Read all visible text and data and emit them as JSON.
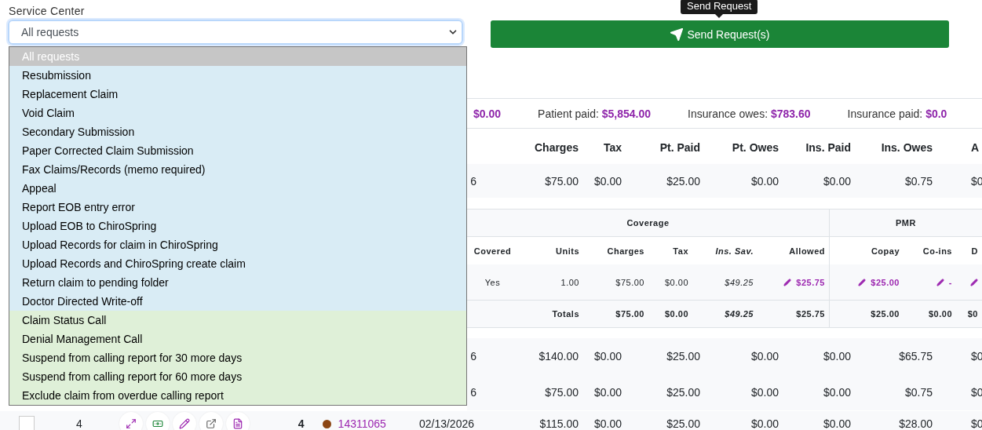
{
  "service_center": {
    "label": "Service Center",
    "value": "All requests",
    "options": [
      {
        "label": "All requests",
        "kind": "request",
        "selected": true
      },
      {
        "label": "Resubmission",
        "kind": "request",
        "selected": false
      },
      {
        "label": "Replacement Claim",
        "kind": "request",
        "selected": false
      },
      {
        "label": "Void Claim",
        "kind": "request",
        "selected": false
      },
      {
        "label": "Secondary Submission",
        "kind": "request",
        "selected": false
      },
      {
        "label": "Paper Corrected Claim Submission",
        "kind": "request",
        "selected": false
      },
      {
        "label": "Fax Claims/Records (memo required)",
        "kind": "request",
        "selected": false
      },
      {
        "label": "Appeal",
        "kind": "request",
        "selected": false
      },
      {
        "label": "Report EOB entry error",
        "kind": "request",
        "selected": false
      },
      {
        "label": "Upload EOB to ChiroSpring",
        "kind": "request",
        "selected": false
      },
      {
        "label": "Upload Records for claim in ChiroSpring",
        "kind": "request",
        "selected": false
      },
      {
        "label": "Upload Records and ChiroSpring create claim",
        "kind": "request",
        "selected": false
      },
      {
        "label": "Return claim to pending folder",
        "kind": "request",
        "selected": false
      },
      {
        "label": "Doctor Directed Write-off",
        "kind": "request",
        "selected": false
      },
      {
        "label": "Claim Status Call",
        "kind": "call",
        "selected": false
      },
      {
        "label": "Denial Management Call",
        "kind": "call",
        "selected": false
      },
      {
        "label": "Suspend from calling report for 30 more days",
        "kind": "call",
        "selected": false
      },
      {
        "label": "Suspend from calling report for 60 more days",
        "kind": "call",
        "selected": false
      },
      {
        "label": "Exclude claim from overdue calling report",
        "kind": "call",
        "selected": false
      }
    ]
  },
  "send_button": {
    "label": "Send Request(s)",
    "tooltip": "Send Request"
  },
  "summary": [
    {
      "value": "$0.00"
    },
    {
      "label": "Patient paid:",
      "value": "$5,854.00"
    },
    {
      "label": "Insurance owes:",
      "value": "$783.60"
    },
    {
      "label": "Insurance paid:",
      "value": "$0.0"
    }
  ],
  "claims": {
    "columns": [
      "Charges",
      "Tax",
      "Pt. Paid",
      "Pt. Owes",
      "Ins. Paid",
      "Ins. Owes",
      "A"
    ],
    "rows": [
      {
        "kind": "partial",
        "date": "6",
        "cells": [
          "$75.00",
          "$0.00",
          "$25.00",
          "$0.00",
          "$0.00",
          "$0.75",
          "$0"
        ],
        "detail": {
          "groups": [
            {
              "label": "Coverage",
              "columns": [
                {
                  "label": "Covered",
                  "kind": "center"
                },
                {
                  "label": "Units",
                  "kind": "amount"
                },
                {
                  "label": "Charges",
                  "kind": "amount"
                },
                {
                  "label": "Tax",
                  "kind": "amount"
                },
                {
                  "label": "Ins. Sav.",
                  "kind": "savings"
                },
                {
                  "label": "Allowed",
                  "kind": "amount"
                }
              ]
            },
            {
              "label": "PMR",
              "columns": [
                {
                  "label": "Copay",
                  "kind": "amount"
                },
                {
                  "label": "Co-ins",
                  "kind": "amount"
                },
                {
                  "label": "D",
                  "kind": "amount"
                }
              ]
            }
          ],
          "line": [
            {
              "text": "Yes",
              "editable": false
            },
            {
              "text": "1.00",
              "editable": false
            },
            {
              "text": "$75.00",
              "editable": false
            },
            {
              "text": "$0.00",
              "editable": false
            },
            {
              "text": "$49.25",
              "editable": false
            },
            {
              "text": "$25.75",
              "editable": true
            },
            {
              "text": "$25.00",
              "editable": true
            },
            {
              "text": "-",
              "editable": true
            },
            {
              "editable": true
            }
          ],
          "totals": {
            "label": "Totals",
            "values": [
              "$75.00",
              "$0.00",
              "$49.25",
              "$25.75",
              "$25.00",
              "$0.00",
              "$0"
            ]
          }
        }
      },
      {
        "kind": "partial",
        "date": "6",
        "cells": [
          "$140.00",
          "$0.00",
          "$25.00",
          "$0.00",
          "$0.00",
          "$65.75",
          "$0"
        ]
      },
      {
        "kind": "partial",
        "date": "6",
        "cells": [
          "$75.00",
          "$0.00",
          "$25.00",
          "$0.00",
          "$0.00",
          "$0.75",
          "$0"
        ]
      },
      {
        "kind": "full",
        "checked": false,
        "number": "4",
        "actions": [
          {
            "kind": "expand"
          },
          {
            "kind": "money"
          },
          {
            "kind": "edit"
          },
          {
            "kind": "link"
          },
          {
            "kind": "file"
          }
        ],
        "visits": "4",
        "color": "#8b4513",
        "claim": "14311065",
        "date": "02/13/2026",
        "cells": [
          "$115.00",
          "$0.00",
          "$25.00",
          "$0.00",
          "$0.00",
          "$28.00",
          "$0"
        ]
      }
    ]
  }
}
